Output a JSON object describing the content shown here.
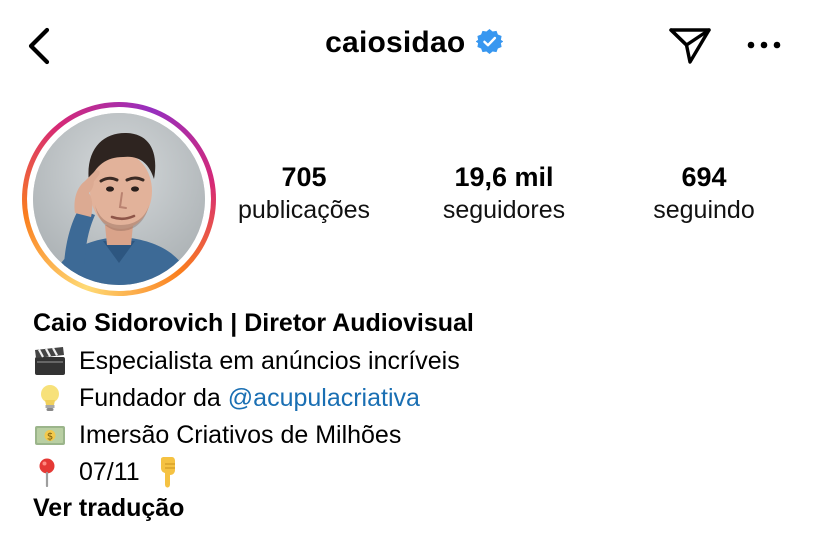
{
  "header": {
    "username": "caiosidao",
    "back_icon": "chevron-left-icon",
    "verified_icon": "verified-badge-icon",
    "send_icon": "paper-plane-icon",
    "more_icon": "more-horizontal-icon"
  },
  "stats": [
    {
      "value": "705",
      "label": "publicações"
    },
    {
      "value": "19,6 mil",
      "label": "seguidores"
    },
    {
      "value": "694",
      "label": "seguindo"
    }
  ],
  "bio": {
    "name": "Caio Sidorovich | Diretor Audiovisual",
    "lines": [
      {
        "emoji": "clapperboard-icon",
        "text": "Especialista em anúncios incríveis"
      },
      {
        "emoji": "light-bulb-icon",
        "text": "Fundador da",
        "mention": "@acupulacriativa"
      },
      {
        "emoji": "money-icon",
        "text": "Imersão Criativos de Milhões"
      },
      {
        "emoji": "pin-icon",
        "text": "07/11",
        "trailing_emoji": "pointing-down-icon"
      }
    ],
    "translate_label": "Ver tradução"
  },
  "colors": {
    "verified_blue": "#3897f0",
    "link_blue": "#1a6fb3",
    "ring_gradient": [
      "#feda75",
      "#fa7e1e",
      "#d62976",
      "#962fbf"
    ]
  }
}
